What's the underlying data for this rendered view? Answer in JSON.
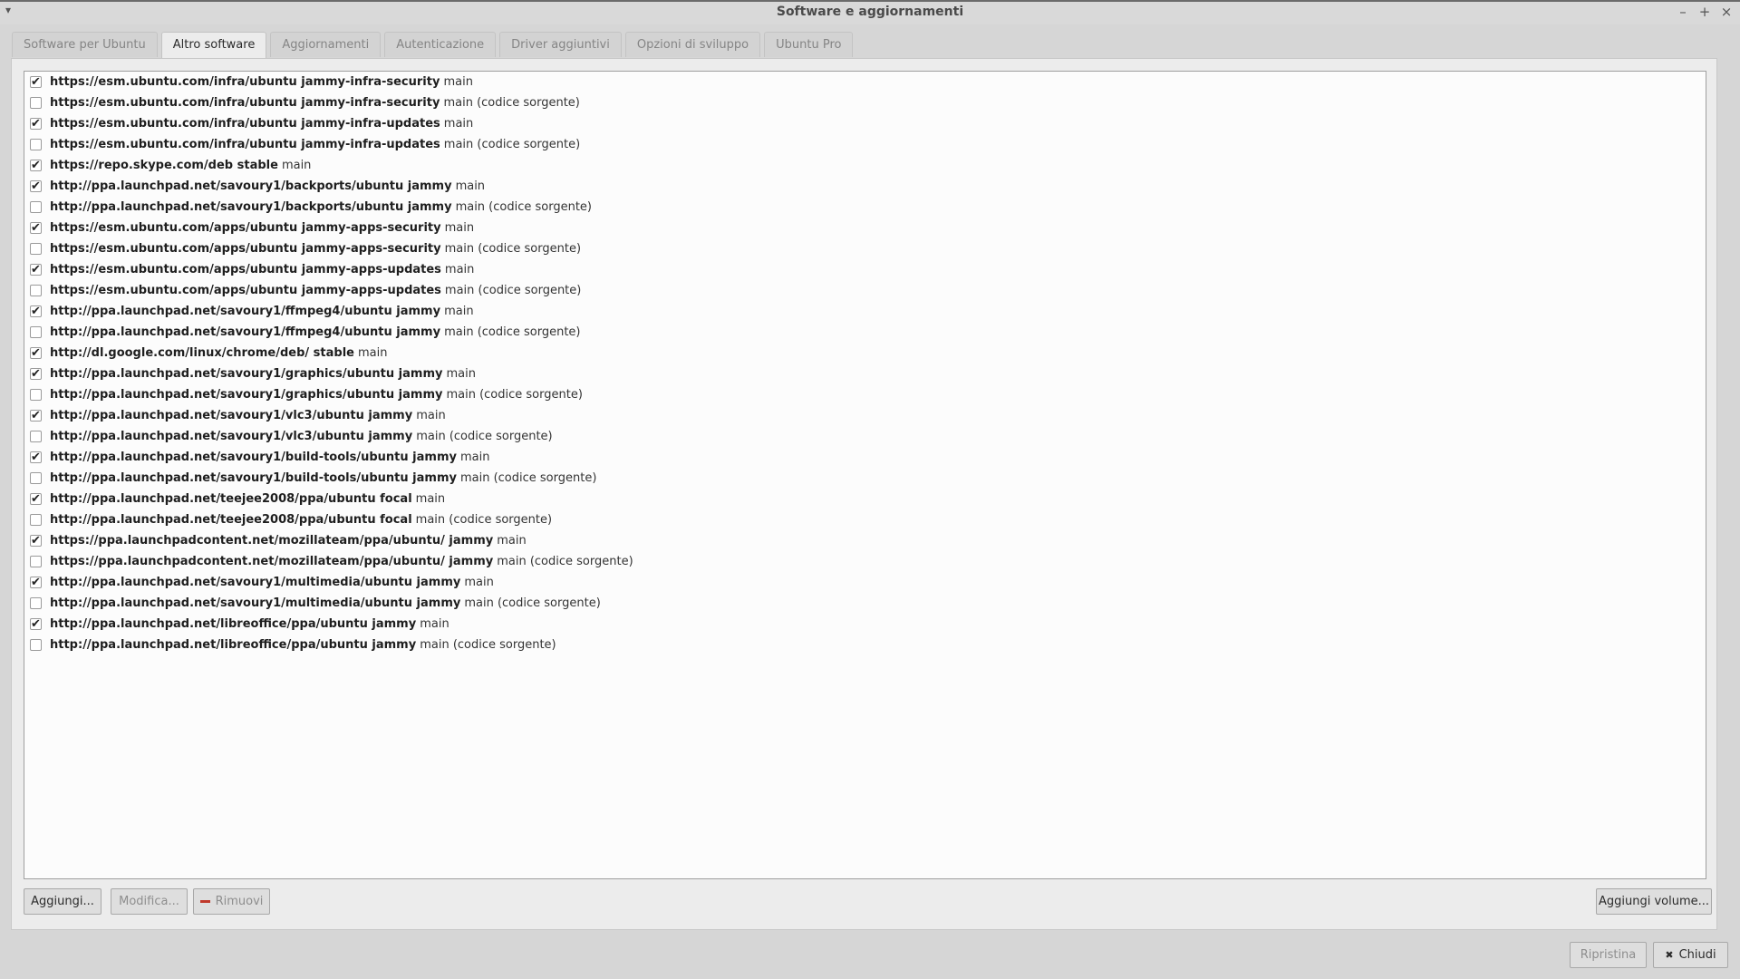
{
  "window": {
    "title": "Software e aggiornamenti",
    "menu_glyph": "▾",
    "min_glyph": "–",
    "max_glyph": "+",
    "close_glyph": "×"
  },
  "tabs": [
    {
      "label": "Software per Ubuntu",
      "active": false
    },
    {
      "label": "Altro software",
      "active": true
    },
    {
      "label": "Aggiornamenti",
      "active": false
    },
    {
      "label": "Autenticazione",
      "active": false
    },
    {
      "label": "Driver aggiuntivi",
      "active": false
    },
    {
      "label": "Opzioni di sviluppo",
      "active": false
    },
    {
      "label": "Ubuntu Pro",
      "active": false
    }
  ],
  "sources": [
    {
      "checked": true,
      "uri": "https://esm.ubuntu.com/infra/ubuntu jammy-infra-security",
      "components": "main"
    },
    {
      "checked": false,
      "uri": "https://esm.ubuntu.com/infra/ubuntu jammy-infra-security",
      "components": "main (codice sorgente)"
    },
    {
      "checked": true,
      "uri": "https://esm.ubuntu.com/infra/ubuntu jammy-infra-updates",
      "components": "main"
    },
    {
      "checked": false,
      "uri": "https://esm.ubuntu.com/infra/ubuntu jammy-infra-updates",
      "components": "main (codice sorgente)"
    },
    {
      "checked": true,
      "uri": "https://repo.skype.com/deb stable",
      "components": "main"
    },
    {
      "checked": true,
      "uri": "http://ppa.launchpad.net/savoury1/backports/ubuntu jammy",
      "components": "main"
    },
    {
      "checked": false,
      "uri": "http://ppa.launchpad.net/savoury1/backports/ubuntu jammy",
      "components": "main (codice sorgente)"
    },
    {
      "checked": true,
      "uri": "https://esm.ubuntu.com/apps/ubuntu jammy-apps-security",
      "components": "main"
    },
    {
      "checked": false,
      "uri": "https://esm.ubuntu.com/apps/ubuntu jammy-apps-security",
      "components": "main (codice sorgente)"
    },
    {
      "checked": true,
      "uri": "https://esm.ubuntu.com/apps/ubuntu jammy-apps-updates",
      "components": "main"
    },
    {
      "checked": false,
      "uri": "https://esm.ubuntu.com/apps/ubuntu jammy-apps-updates",
      "components": "main (codice sorgente)"
    },
    {
      "checked": true,
      "uri": "http://ppa.launchpad.net/savoury1/ffmpeg4/ubuntu jammy",
      "components": "main"
    },
    {
      "checked": false,
      "uri": "http://ppa.launchpad.net/savoury1/ffmpeg4/ubuntu jammy",
      "components": "main (codice sorgente)"
    },
    {
      "checked": true,
      "uri": "http://dl.google.com/linux/chrome/deb/ stable",
      "components": "main"
    },
    {
      "checked": true,
      "uri": "http://ppa.launchpad.net/savoury1/graphics/ubuntu jammy",
      "components": "main"
    },
    {
      "checked": false,
      "uri": "http://ppa.launchpad.net/savoury1/graphics/ubuntu jammy",
      "components": "main (codice sorgente)"
    },
    {
      "checked": true,
      "uri": "http://ppa.launchpad.net/savoury1/vlc3/ubuntu jammy",
      "components": "main"
    },
    {
      "checked": false,
      "uri": "http://ppa.launchpad.net/savoury1/vlc3/ubuntu jammy",
      "components": "main (codice sorgente)"
    },
    {
      "checked": true,
      "uri": "http://ppa.launchpad.net/savoury1/build-tools/ubuntu jammy",
      "components": "main"
    },
    {
      "checked": false,
      "uri": "http://ppa.launchpad.net/savoury1/build-tools/ubuntu jammy",
      "components": "main (codice sorgente)"
    },
    {
      "checked": true,
      "uri": "http://ppa.launchpad.net/teejee2008/ppa/ubuntu focal",
      "components": "main"
    },
    {
      "checked": false,
      "uri": "http://ppa.launchpad.net/teejee2008/ppa/ubuntu focal",
      "components": "main (codice sorgente)"
    },
    {
      "checked": true,
      "uri": "https://ppa.launchpadcontent.net/mozillateam/ppa/ubuntu/ jammy",
      "components": "main"
    },
    {
      "checked": false,
      "uri": "https://ppa.launchpadcontent.net/mozillateam/ppa/ubuntu/ jammy",
      "components": "main (codice sorgente)"
    },
    {
      "checked": true,
      "uri": "http://ppa.launchpad.net/savoury1/multimedia/ubuntu jammy",
      "components": "main"
    },
    {
      "checked": false,
      "uri": "http://ppa.launchpad.net/savoury1/multimedia/ubuntu jammy",
      "components": "main (codice sorgente)"
    },
    {
      "checked": true,
      "uri": "http://ppa.launchpad.net/libreoffice/ppa/ubuntu jammy",
      "components": "main"
    },
    {
      "checked": false,
      "uri": "http://ppa.launchpad.net/libreoffice/ppa/ubuntu jammy",
      "components": "main (codice sorgente)"
    }
  ],
  "buttons": {
    "add": "Aggiungi...",
    "edit": "Modifica...",
    "remove": "Rimuovi",
    "add_volume": "Aggiungi volume...",
    "revert": "Ripristina",
    "close": "Chiudi",
    "close_glyph": "✖"
  },
  "colors": {
    "remove_icon": "#c0392b",
    "background": "#d6d6d6",
    "list_background": "#fcfcfc"
  },
  "check_glyph": "✔"
}
